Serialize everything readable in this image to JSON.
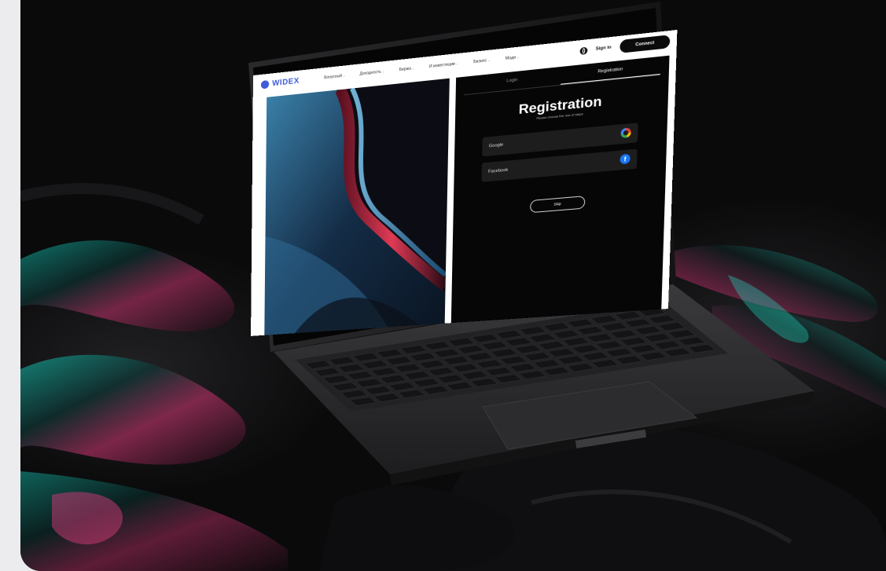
{
  "nav": {
    "logo": "WIDEX",
    "menu": [
      "Бонусный",
      "Доходность",
      "Биржа",
      "И инвестиции",
      "Бизнес",
      "Моди"
    ],
    "sign_in": "Sign in",
    "connect": "Connect"
  },
  "panel": {
    "tabs": [
      {
        "label": "Login",
        "active": false
      },
      {
        "label": "Registration",
        "active": true
      }
    ],
    "title": "Registration",
    "subtitle": "Please choose the one of steps",
    "google": "Google",
    "facebook": "Facebook",
    "skip": "Skip",
    "facebook_glyph": "f"
  },
  "colors": {
    "brand": "#3f5bd8",
    "panel": "#060606",
    "google_btn": "#1d1d1e",
    "facebook": "#1877f2"
  }
}
